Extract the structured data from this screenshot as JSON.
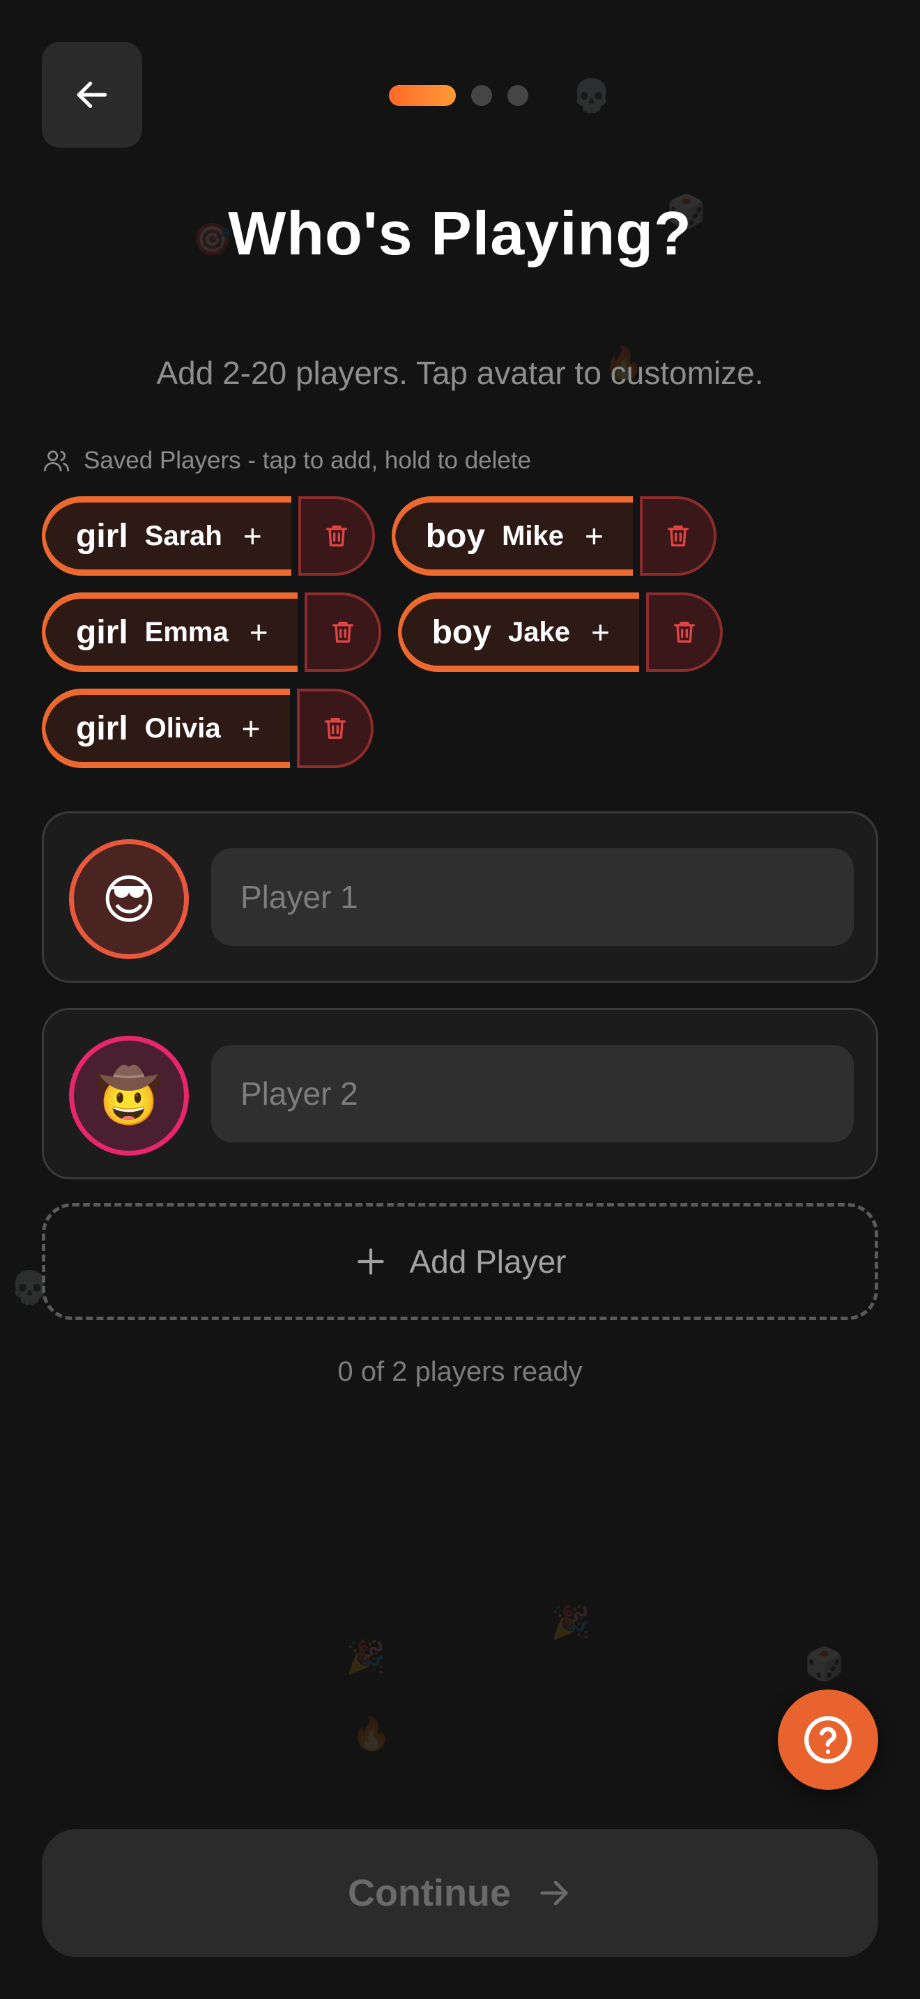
{
  "header": {
    "back_icon": "arrow-left-icon",
    "progress": {
      "current_step": 1,
      "total_steps": 3,
      "accent": "#ff7a2f"
    }
  },
  "title": "Who's Playing?",
  "subtitle": "Add 2-20 players. Tap avatar to customize.",
  "saved_players": {
    "label": "Saved Players - tap to add, hold to delete",
    "icon": "users-icon",
    "items": [
      {
        "gender": "girl",
        "name": "Sarah",
        "add": "+"
      },
      {
        "gender": "boy",
        "name": "Mike",
        "add": "+"
      },
      {
        "gender": "girl",
        "name": "Emma",
        "add": "+"
      },
      {
        "gender": "boy",
        "name": "Jake",
        "add": "+"
      },
      {
        "gender": "girl",
        "name": "Olivia",
        "add": "+"
      }
    ]
  },
  "players": [
    {
      "avatar": "😎",
      "placeholder": "Player 1",
      "value": "",
      "ring_color": "#e8583c"
    },
    {
      "avatar": "🤠",
      "placeholder": "Player 2",
      "value": "",
      "ring_color": "#e8266b"
    }
  ],
  "add_player_label": "Add Player",
  "ready_status": "0 of 2 players ready",
  "help_icon": "question-icon",
  "continue_label": "Continue",
  "colors": {
    "accent": "#ee6a30",
    "delete": "#e04545",
    "background": "#131313"
  }
}
